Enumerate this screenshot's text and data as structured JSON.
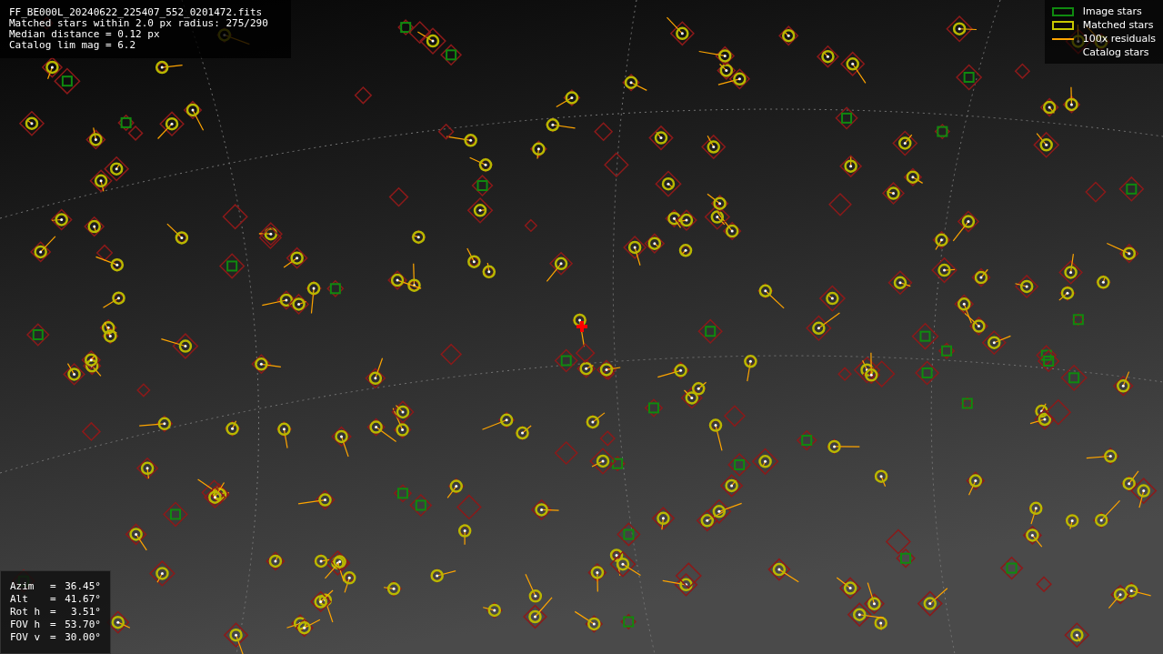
{
  "info": {
    "lines": [
      "FF_BE000L_20240622_225407_552_0201472.fits",
      "Matched stars within 2.0 px radius: 275/290",
      "Median distance = 0.12 px",
      "Catalog lim mag = 6.2"
    ]
  },
  "legend": [
    {
      "kind": "box",
      "color": "#0f8a0f",
      "label": "Image stars"
    },
    {
      "kind": "box",
      "color": "#c8c800",
      "label": "Matched stars"
    },
    {
      "kind": "line",
      "color": "#ffa500",
      "label": "100x residuals"
    },
    {
      "kind": "none",
      "label": "Catalog stars"
    }
  ],
  "pointing": [
    {
      "label": "Azim",
      "sign": "=",
      "value": "36.45°"
    },
    {
      "label": "Alt",
      "sign": "=",
      "value": "41.67°"
    },
    {
      "label": "Rot h",
      "sign": "=",
      "value": "3.51°"
    },
    {
      "label": "FOV h",
      "sign": "=",
      "value": "53.70°"
    },
    {
      "label": "FOV v",
      "sign": "=",
      "value": "30.00°"
    }
  ]
}
